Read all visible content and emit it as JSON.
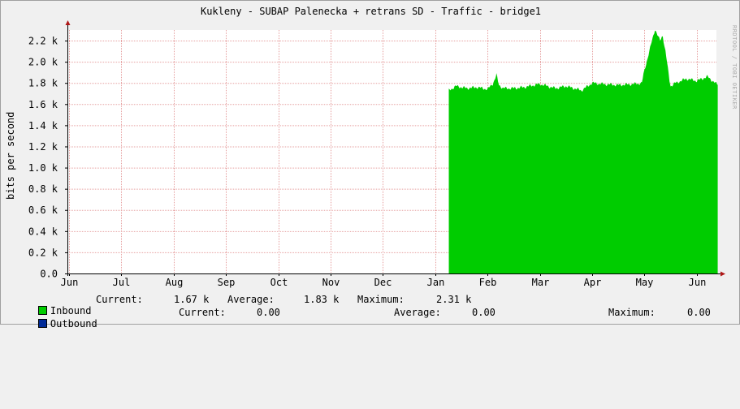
{
  "title": "Kukleny - SUBAP Palenecka + retrans SD - Traffic - bridge1",
  "vendor_text": "RRDTOOL / TOBI OETIKER",
  "colors": {
    "background": "#f0f0f0",
    "plot_background": "#ffffff",
    "grid": "#e6a0a0",
    "axis": "#000000",
    "inbound": "#00cc00",
    "outbound": "#002a97",
    "arrow": "#b01818"
  },
  "legend": {
    "inbound": {
      "label": "Inbound",
      "current_label": "Current:",
      "current_value": "1.67 k",
      "average_label": "Average:",
      "average_value": "1.83 k",
      "maximum_label": "Maximum:",
      "maximum_value": "2.31 k"
    },
    "outbound": {
      "label": "Outbound",
      "current_label": "Current:",
      "current_value": "0.00",
      "average_label": "Average:",
      "average_value": "0.00",
      "maximum_label": "Maximum:",
      "maximum_value": "0.00"
    }
  },
  "chart_data": {
    "type": "area",
    "title": "Kukleny - SUBAP Palenecka + retrans SD - Traffic - bridge1",
    "ylabel": "bits per second",
    "xlabel": "",
    "ylim": [
      0,
      2300
    ],
    "y_ticks": [
      0,
      200,
      400,
      600,
      800,
      1000,
      1200,
      1400,
      1600,
      1800,
      2000,
      2200
    ],
    "y_tick_labels": [
      "0.0",
      "0.2 k",
      "0.4 k",
      "0.6 k",
      "0.8 k",
      "1.0 k",
      "1.2 k",
      "1.4 k",
      "1.6 k",
      "1.8 k",
      "2.0 k",
      "2.2 k"
    ],
    "x_months": [
      "Jun",
      "Jul",
      "Aug",
      "Sep",
      "Oct",
      "Nov",
      "Dec",
      "Jan",
      "Feb",
      "Mar",
      "Apr",
      "May",
      "Jun"
    ],
    "grid": true,
    "series": [
      {
        "name": "Inbound",
        "color": "#00cc00",
        "x": [
          7.26,
          7.4,
          7.6,
          7.8,
          8.0,
          8.1,
          8.17,
          8.22,
          8.3,
          8.5,
          8.7,
          9.0,
          9.3,
          9.5,
          9.8,
          10.0,
          10.2,
          10.5,
          10.8,
          10.95,
          11.0,
          11.2,
          11.3,
          11.35,
          11.4,
          11.5,
          11.6,
          11.8,
          12.0,
          12.2,
          12.4
        ],
        "values": [
          1730,
          1770,
          1750,
          1760,
          1740,
          1790,
          1880,
          1780,
          1750,
          1750,
          1760,
          1790,
          1750,
          1770,
          1730,
          1800,
          1790,
          1780,
          1790,
          1800,
          1920,
          2310,
          2200,
          2250,
          2100,
          1770,
          1800,
          1840,
          1820,
          1860,
          1780
        ]
      },
      {
        "name": "Outbound",
        "color": "#002a97",
        "x": [
          7.26,
          12.4
        ],
        "values": [
          0,
          0
        ]
      }
    ]
  }
}
